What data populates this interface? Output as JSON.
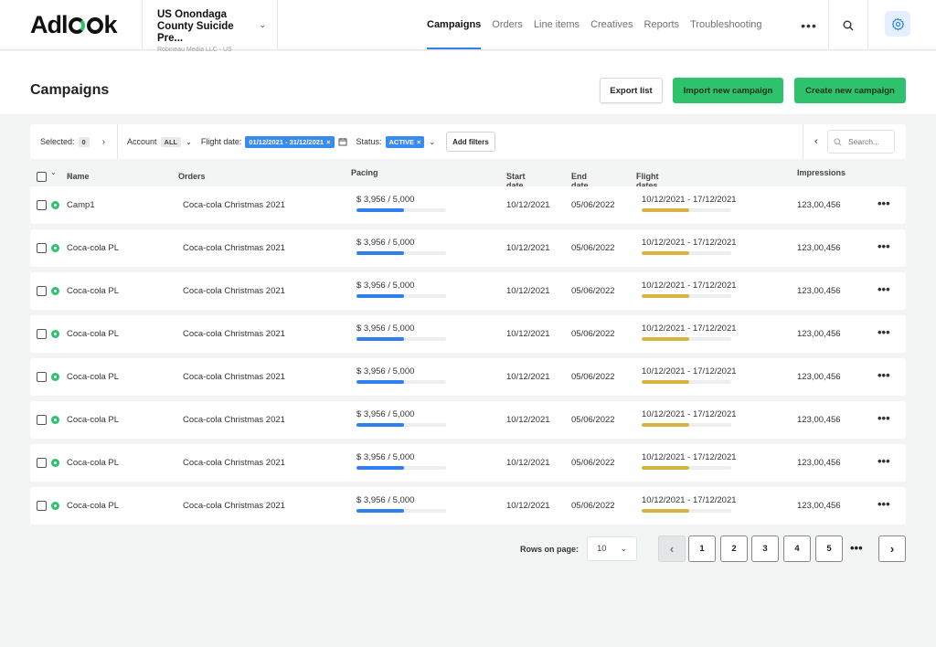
{
  "brand": {
    "logo_a": "Adl",
    "logo_b": "k",
    "green": "#2ec26c",
    "blue": "#2f80ed",
    "gold": "#d8b43f"
  },
  "account": {
    "name": "US Onondaga County Suicide Pre...",
    "sub": "Robineau Media LLC - US"
  },
  "nav": [
    "Campaigns",
    "Orders",
    "Line items",
    "Creatives",
    "Reports",
    "Troubleshooting"
  ],
  "nav_more": "•••",
  "page": {
    "title": "Campaigns"
  },
  "buttons": {
    "export": "Export list",
    "import": "Import new campaign",
    "create": "Create new campaign"
  },
  "filters": {
    "selected_label": "Selected:",
    "selected_count": "0",
    "account_label": "Account",
    "account_value": "ALL",
    "flight_label": "Flight date:",
    "flight_value": "01/12/2021 - 31/12/2021",
    "status_label": "Status:",
    "status_value": "ACTIVE",
    "add_filters": "Add filters",
    "search_placeholder": "Search..."
  },
  "columns": {
    "name": "Name",
    "orders": "Orders",
    "pacing": "Pacing",
    "start": "Start date",
    "end": "End date",
    "flight": "Flight dates",
    "impressions": "Impressions"
  },
  "rows": [
    {
      "name": "Camp1",
      "order": "Coca-cola Christmas 2021",
      "pacing": "$ 3,956 / 5,000",
      "pacing_pct": 0.53,
      "start": "10/12/2021",
      "end": "05/06/2022",
      "flight": "10/12/2021 - 17/12/2021",
      "flight_pct": 0.53,
      "impressions": "123,00,456"
    },
    {
      "name": "Coca-cola PL",
      "order": "Coca-cola Christmas 2021",
      "pacing": "$ 3,956 / 5,000",
      "pacing_pct": 0.53,
      "start": "10/12/2021",
      "end": "05/06/2022",
      "flight": "10/12/2021 - 17/12/2021",
      "flight_pct": 0.53,
      "impressions": "123,00,456"
    },
    {
      "name": "Coca-cola PL",
      "order": "Coca-cola Christmas 2021",
      "pacing": "$ 3,956 / 5,000",
      "pacing_pct": 0.53,
      "start": "10/12/2021",
      "end": "05/06/2022",
      "flight": "10/12/2021 - 17/12/2021",
      "flight_pct": 0.53,
      "impressions": "123,00,456"
    },
    {
      "name": "Coca-cola PL",
      "order": "Coca-cola Christmas 2021",
      "pacing": "$ 3,956 / 5,000",
      "pacing_pct": 0.53,
      "start": "10/12/2021",
      "end": "05/06/2022",
      "flight": "10/12/2021 - 17/12/2021",
      "flight_pct": 0.53,
      "impressions": "123,00,456"
    },
    {
      "name": "Coca-cola PL",
      "order": "Coca-cola Christmas 2021",
      "pacing": "$ 3,956 / 5,000",
      "pacing_pct": 0.53,
      "start": "10/12/2021",
      "end": "05/06/2022",
      "flight": "10/12/2021 - 17/12/2021",
      "flight_pct": 0.53,
      "impressions": "123,00,456"
    },
    {
      "name": "Coca-cola PL",
      "order": "Coca-cola Christmas 2021",
      "pacing": "$ 3,956 / 5,000",
      "pacing_pct": 0.53,
      "start": "10/12/2021",
      "end": "05/06/2022",
      "flight": "10/12/2021 - 17/12/2021",
      "flight_pct": 0.53,
      "impressions": "123,00,456"
    },
    {
      "name": "Coca-cola PL",
      "order": "Coca-cola Christmas 2021",
      "pacing": "$ 3,956 / 5,000",
      "pacing_pct": 0.53,
      "start": "10/12/2021",
      "end": "05/06/2022",
      "flight": "10/12/2021 - 17/12/2021",
      "flight_pct": 0.53,
      "impressions": "123,00,456"
    },
    {
      "name": "Coca-cola PL",
      "order": "Coca-cola Christmas 2021",
      "pacing": "$ 3,956 / 5,000",
      "pacing_pct": 0.53,
      "start": "10/12/2021",
      "end": "05/06/2022",
      "flight": "10/12/2021 - 17/12/2021",
      "flight_pct": 0.53,
      "impressions": "123,00,456"
    }
  ],
  "pagination": {
    "rows_label": "Rows on page:",
    "rows_value": "10",
    "pages": [
      "1",
      "2",
      "3",
      "4",
      "5"
    ],
    "ellipsis": "•••"
  }
}
